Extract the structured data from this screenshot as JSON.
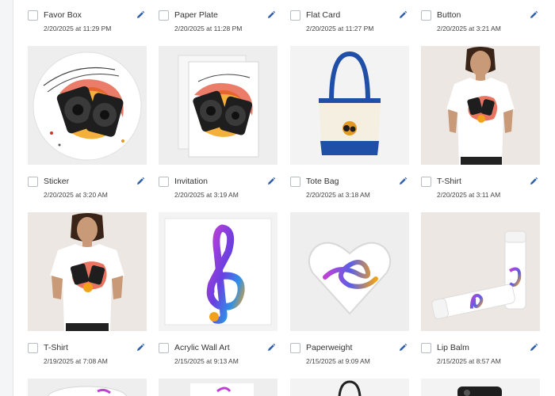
{
  "products": [
    {
      "name": "Favor Box",
      "date": "2/20/2025 at 11:29 PM"
    },
    {
      "name": "Paper Plate",
      "date": "2/20/2025 at 11:28 PM"
    },
    {
      "name": "Flat Card",
      "date": "2/20/2025 at 11:27 PM"
    },
    {
      "name": "Button",
      "date": "2/20/2025 at 3:21 AM"
    },
    {
      "name": "Sticker",
      "date": "2/20/2025 at 3:20 AM"
    },
    {
      "name": "Invitation",
      "date": "2/20/2025 at 3:19 AM"
    },
    {
      "name": "Tote Bag",
      "date": "2/20/2025 at 3:18 AM"
    },
    {
      "name": "T-Shirt",
      "date": "2/20/2025 at 3:11 AM"
    },
    {
      "name": "T-Shirt",
      "date": "2/19/2025 at 7:08 AM"
    },
    {
      "name": "Acrylic Wall Art",
      "date": "2/15/2025 at 9:13 AM"
    },
    {
      "name": "Paperweight",
      "date": "2/15/2025 at 9:09 AM"
    },
    {
      "name": "Lip Balm",
      "date": "2/15/2025 at 8:57 AM"
    }
  ],
  "colors": {
    "edit_icon": "#2f5fa8",
    "checkbox_border": "#b8bcc3",
    "accent_blue": "#1f4fa6"
  },
  "icons": {
    "edit": "pencil-icon",
    "select": "checkbox"
  }
}
